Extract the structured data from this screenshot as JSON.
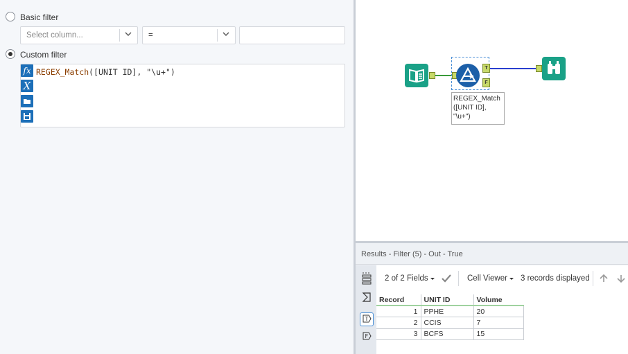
{
  "filter": {
    "basic_label": "Basic filter",
    "custom_label": "Custom filter",
    "selected_mode": "custom",
    "column_placeholder": "Select column...",
    "operator_value": "=",
    "value_text": "",
    "expression_function": "REGEX_Match",
    "expression_args": "([UNIT ID], \"\\u+\")"
  },
  "canvas": {
    "annotation": "REGEX_Match ([UNIT ID], \"\\u+\")",
    "true_anchor": "T",
    "false_anchor": "F"
  },
  "results": {
    "title": "Results - Filter (5) - Out - True",
    "fields_label": "2 of 2 Fields",
    "viewer_label": "Cell Viewer",
    "records_label": "3 records displayed",
    "columns": [
      "Record",
      "UNIT ID",
      "Volume"
    ],
    "rows": [
      {
        "record": "1",
        "unit_id": "PPHE",
        "volume": "20"
      },
      {
        "record": "2",
        "unit_id": "CCIS",
        "volume": "7"
      },
      {
        "record": "3",
        "unit_id": "BCFS",
        "volume": "15"
      }
    ],
    "side_icons": [
      "T",
      "F"
    ]
  },
  "colors": {
    "tool_teal": "#1aa187",
    "filter_blue": "#1c5fa8",
    "connection_green": "#3a9a3a",
    "connection_blue": "#2a3fcf"
  }
}
